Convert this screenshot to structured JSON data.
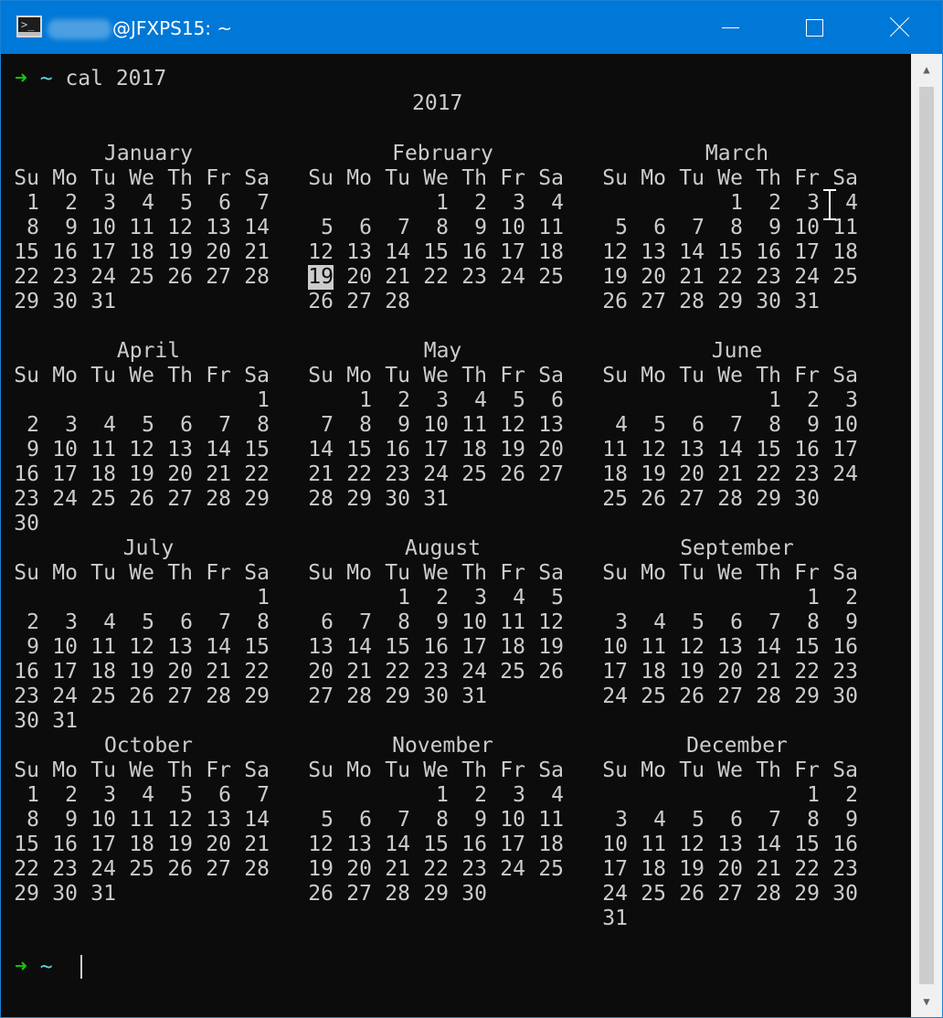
{
  "window": {
    "title_user_blurred": "admin",
    "title_host": "@JFXPS15: ~",
    "app_icon_glyph": ">_",
    "buttons": {
      "minimize": "minimize-icon",
      "maximize": "maximize-icon",
      "close": "close-icon"
    },
    "accent_color": "#0078d7"
  },
  "terminal": {
    "prompt_arrow": "➜",
    "prompt_dir": "~",
    "command": "cal 2017",
    "year_title": "2017",
    "weekdays": [
      "Su",
      "Mo",
      "Tu",
      "We",
      "Th",
      "Fr",
      "Sa"
    ],
    "today": {
      "month": "February",
      "day": "19"
    },
    "months": [
      {
        "name": "January",
        "weeks": [
          [
            "1",
            "2",
            "3",
            "4",
            "5",
            "6",
            "7"
          ],
          [
            "8",
            "9",
            "10",
            "11",
            "12",
            "13",
            "14"
          ],
          [
            "15",
            "16",
            "17",
            "18",
            "19",
            "20",
            "21"
          ],
          [
            "22",
            "23",
            "24",
            "25",
            "26",
            "27",
            "28"
          ],
          [
            "29",
            "30",
            "31",
            "",
            "",
            "",
            ""
          ]
        ]
      },
      {
        "name": "February",
        "weeks": [
          [
            "",
            "",
            "",
            "1",
            "2",
            "3",
            "4"
          ],
          [
            "5",
            "6",
            "7",
            "8",
            "9",
            "10",
            "11"
          ],
          [
            "12",
            "13",
            "14",
            "15",
            "16",
            "17",
            "18"
          ],
          [
            "19",
            "20",
            "21",
            "22",
            "23",
            "24",
            "25"
          ],
          [
            "26",
            "27",
            "28",
            "",
            "",
            "",
            ""
          ]
        ]
      },
      {
        "name": "March",
        "weeks": [
          [
            "",
            "",
            "",
            "1",
            "2",
            "3",
            "4"
          ],
          [
            "5",
            "6",
            "7",
            "8",
            "9",
            "10",
            "11"
          ],
          [
            "12",
            "13",
            "14",
            "15",
            "16",
            "17",
            "18"
          ],
          [
            "19",
            "20",
            "21",
            "22",
            "23",
            "24",
            "25"
          ],
          [
            "26",
            "27",
            "28",
            "29",
            "30",
            "31",
            ""
          ]
        ]
      },
      {
        "name": "April",
        "weeks": [
          [
            "",
            "",
            "",
            "",
            "",
            "",
            "1"
          ],
          [
            "2",
            "3",
            "4",
            "5",
            "6",
            "7",
            "8"
          ],
          [
            "9",
            "10",
            "11",
            "12",
            "13",
            "14",
            "15"
          ],
          [
            "16",
            "17",
            "18",
            "19",
            "20",
            "21",
            "22"
          ],
          [
            "23",
            "24",
            "25",
            "26",
            "27",
            "28",
            "29"
          ],
          [
            "30",
            "",
            "",
            "",
            "",
            "",
            ""
          ]
        ]
      },
      {
        "name": "May",
        "weeks": [
          [
            "",
            "1",
            "2",
            "3",
            "4",
            "5",
            "6"
          ],
          [
            "7",
            "8",
            "9",
            "10",
            "11",
            "12",
            "13"
          ],
          [
            "14",
            "15",
            "16",
            "17",
            "18",
            "19",
            "20"
          ],
          [
            "21",
            "22",
            "23",
            "24",
            "25",
            "26",
            "27"
          ],
          [
            "28",
            "29",
            "30",
            "31",
            "",
            "",
            ""
          ]
        ]
      },
      {
        "name": "June",
        "weeks": [
          [
            "",
            "",
            "",
            "",
            "1",
            "2",
            "3"
          ],
          [
            "4",
            "5",
            "6",
            "7",
            "8",
            "9",
            "10"
          ],
          [
            "11",
            "12",
            "13",
            "14",
            "15",
            "16",
            "17"
          ],
          [
            "18",
            "19",
            "20",
            "21",
            "22",
            "23",
            "24"
          ],
          [
            "25",
            "26",
            "27",
            "28",
            "29",
            "30",
            ""
          ]
        ]
      },
      {
        "name": "July",
        "weeks": [
          [
            "",
            "",
            "",
            "",
            "",
            "",
            "1"
          ],
          [
            "2",
            "3",
            "4",
            "5",
            "6",
            "7",
            "8"
          ],
          [
            "9",
            "10",
            "11",
            "12",
            "13",
            "14",
            "15"
          ],
          [
            "16",
            "17",
            "18",
            "19",
            "20",
            "21",
            "22"
          ],
          [
            "23",
            "24",
            "25",
            "26",
            "27",
            "28",
            "29"
          ],
          [
            "30",
            "31",
            "",
            "",
            "",
            "",
            ""
          ]
        ]
      },
      {
        "name": "August",
        "weeks": [
          [
            "",
            "",
            "1",
            "2",
            "3",
            "4",
            "5"
          ],
          [
            "6",
            "7",
            "8",
            "9",
            "10",
            "11",
            "12"
          ],
          [
            "13",
            "14",
            "15",
            "16",
            "17",
            "18",
            "19"
          ],
          [
            "20",
            "21",
            "22",
            "23",
            "24",
            "25",
            "26"
          ],
          [
            "27",
            "28",
            "29",
            "30",
            "31",
            "",
            ""
          ]
        ]
      },
      {
        "name": "September",
        "weeks": [
          [
            "",
            "",
            "",
            "",
            "",
            "1",
            "2"
          ],
          [
            "3",
            "4",
            "5",
            "6",
            "7",
            "8",
            "9"
          ],
          [
            "10",
            "11",
            "12",
            "13",
            "14",
            "15",
            "16"
          ],
          [
            "17",
            "18",
            "19",
            "20",
            "21",
            "22",
            "23"
          ],
          [
            "24",
            "25",
            "26",
            "27",
            "28",
            "29",
            "30"
          ]
        ]
      },
      {
        "name": "October",
        "weeks": [
          [
            "1",
            "2",
            "3",
            "4",
            "5",
            "6",
            "7"
          ],
          [
            "8",
            "9",
            "10",
            "11",
            "12",
            "13",
            "14"
          ],
          [
            "15",
            "16",
            "17",
            "18",
            "19",
            "20",
            "21"
          ],
          [
            "22",
            "23",
            "24",
            "25",
            "26",
            "27",
            "28"
          ],
          [
            "29",
            "30",
            "31",
            "",
            "",
            "",
            ""
          ]
        ]
      },
      {
        "name": "November",
        "weeks": [
          [
            "",
            "",
            "",
            "1",
            "2",
            "3",
            "4"
          ],
          [
            "5",
            "6",
            "7",
            "8",
            "9",
            "10",
            "11"
          ],
          [
            "12",
            "13",
            "14",
            "15",
            "16",
            "17",
            "18"
          ],
          [
            "19",
            "20",
            "21",
            "22",
            "23",
            "24",
            "25"
          ],
          [
            "26",
            "27",
            "28",
            "29",
            "30",
            "",
            ""
          ]
        ]
      },
      {
        "name": "December",
        "weeks": [
          [
            "",
            "",
            "",
            "",
            "",
            "1",
            "2"
          ],
          [
            "3",
            "4",
            "5",
            "6",
            "7",
            "8",
            "9"
          ],
          [
            "10",
            "11",
            "12",
            "13",
            "14",
            "15",
            "16"
          ],
          [
            "17",
            "18",
            "19",
            "20",
            "21",
            "22",
            "23"
          ],
          [
            "24",
            "25",
            "26",
            "27",
            "28",
            "29",
            "30"
          ],
          [
            "31",
            "",
            "",
            "",
            "",
            "",
            ""
          ]
        ]
      }
    ],
    "colors": {
      "foreground": "#cccccc",
      "background": "#0c0c0c",
      "arrow": "#16c60c",
      "dir": "#61d6d6"
    }
  }
}
